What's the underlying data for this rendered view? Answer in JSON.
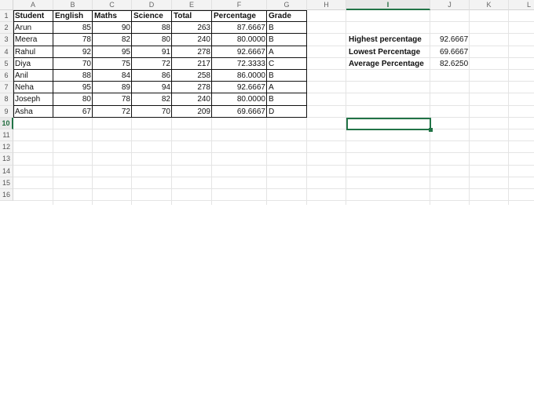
{
  "columns": [
    "A",
    "B",
    "C",
    "D",
    "E",
    "F",
    "G",
    "H",
    "I",
    "J",
    "K",
    "L"
  ],
  "rows": [
    "1",
    "2",
    "3",
    "4",
    "5",
    "6",
    "7",
    "8",
    "9",
    "10",
    "11",
    "12",
    "13",
    "14",
    "15",
    "16"
  ],
  "active_cell": "I10",
  "table": {
    "headers": [
      "Student",
      "English",
      "Maths",
      "Science",
      "Total",
      "Percentage",
      "Grade"
    ],
    "data": [
      [
        "Arun",
        "85",
        "90",
        "88",
        "263",
        "87.6667",
        "B"
      ],
      [
        "Meera",
        "78",
        "82",
        "80",
        "240",
        "80.0000",
        "B"
      ],
      [
        "Rahul",
        "92",
        "95",
        "91",
        "278",
        "92.6667",
        "A"
      ],
      [
        "Diya",
        "70",
        "75",
        "72",
        "217",
        "72.3333",
        "C"
      ],
      [
        "Anil",
        "88",
        "84",
        "86",
        "258",
        "86.0000",
        "B"
      ],
      [
        "Neha",
        "95",
        "89",
        "94",
        "278",
        "92.6667",
        "A"
      ],
      [
        "Joseph",
        "80",
        "78",
        "82",
        "240",
        "80.0000",
        "B"
      ],
      [
        "Asha",
        "67",
        "72",
        "70",
        "209",
        "69.6667",
        "D"
      ]
    ]
  },
  "stats": [
    {
      "label": "Highest percentage",
      "value": "92.6667"
    },
    {
      "label": "Lowest Percentage",
      "value": "69.6667"
    },
    {
      "label": "Average Percentage",
      "value": "82.6250"
    }
  ],
  "colors": {
    "selection": "#217346",
    "gridline": "#e4e4e4",
    "header_bg": "#f3f3f3"
  }
}
